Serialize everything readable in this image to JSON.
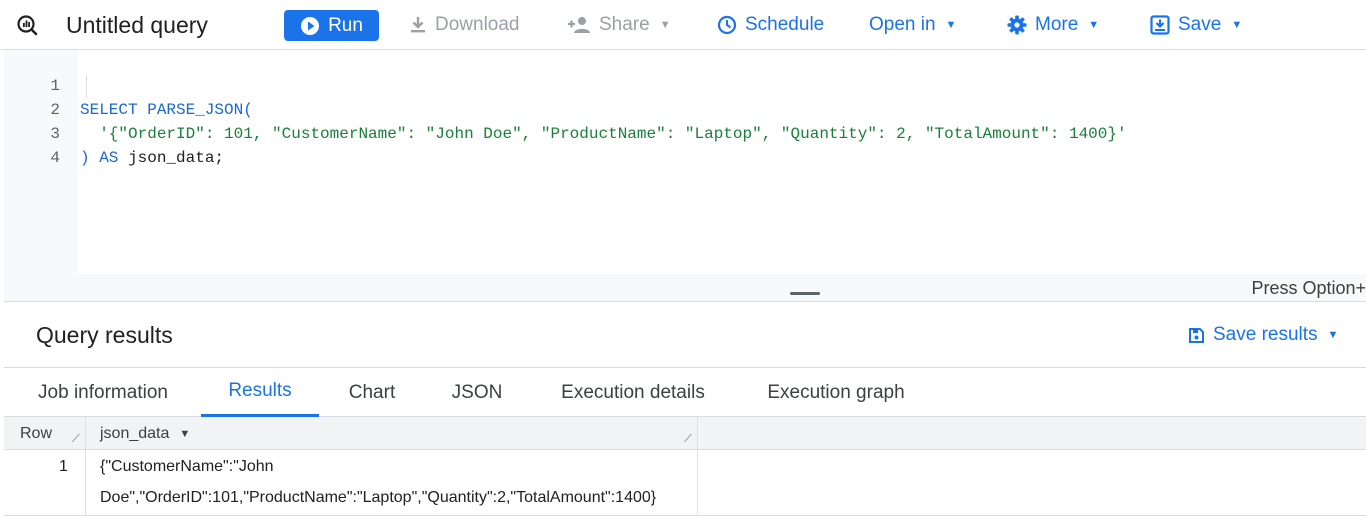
{
  "toolbar": {
    "icon": "query-icon",
    "title": "Untitled query",
    "run_label": "Run",
    "download_label": "Download",
    "share_label": "Share",
    "schedule_label": "Schedule",
    "open_in_label": "Open in",
    "more_label": "More",
    "save_label": "Save"
  },
  "editor": {
    "lines": [
      {
        "num": "1",
        "kw": "SELECT PARSE_JSON(",
        "str": "",
        "plain": ""
      },
      {
        "num": "2",
        "kw": "",
        "str": "  '{\"OrderID\": 101, \"CustomerName\": \"John Doe\", \"ProductName\": \"Laptop\", \"Quantity\": 2, \"TotalAmount\": 1400}'",
        "plain": ""
      },
      {
        "num": "3",
        "kw": ") AS",
        "str": "",
        "plain": " json_data;"
      },
      {
        "num": "4",
        "kw": "",
        "str": "",
        "plain": ""
      }
    ],
    "hint": "Press Option+"
  },
  "results": {
    "title": "Query results",
    "save_results_label": "Save results",
    "tabs": [
      "Job information",
      "Results",
      "Chart",
      "JSON",
      "Execution details",
      "Execution graph"
    ],
    "active_tab": "Results",
    "columns": [
      "Row",
      "json_data"
    ],
    "rows": [
      {
        "row": "1",
        "json_line1": "{\"CustomerName\":\"John",
        "json_line2": "Doe\",\"OrderID\":101,\"ProductName\":\"Laptop\",\"Quantity\":2,\"TotalAmount\":1400}"
      }
    ]
  },
  "colors": {
    "accent": "#1a73e8",
    "keyword": "#1967d2",
    "string": "#188038"
  }
}
